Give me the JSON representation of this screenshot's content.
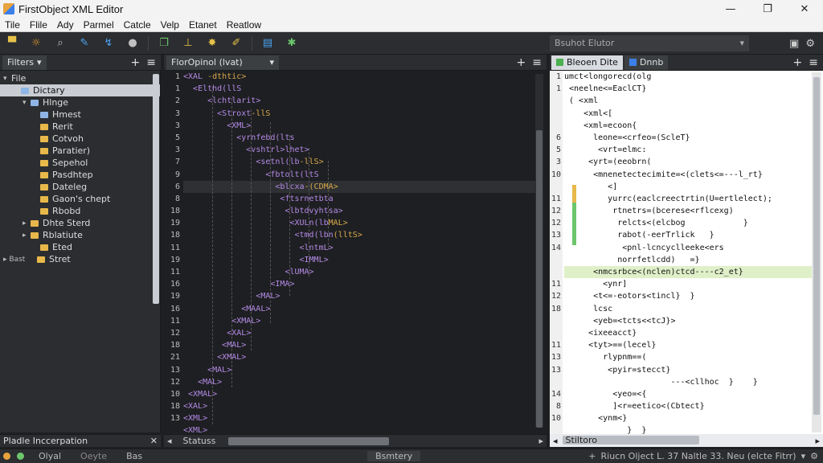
{
  "window": {
    "title": "FirstObject XML Editor",
    "controls": [
      "—",
      "❐",
      "✕"
    ]
  },
  "menu": [
    "Tile",
    "Flile",
    "Ady",
    "Parmel",
    "Catcle",
    "Velp",
    "Etanet",
    "Reatlow"
  ],
  "toolbar": {
    "icons": [
      {
        "name": "save-icon",
        "glyph": "▀",
        "color": "c1"
      },
      {
        "name": "sun-icon",
        "glyph": "☼",
        "color": "c2"
      },
      {
        "name": "search-icon",
        "glyph": "⌕",
        "color": "c3"
      },
      {
        "name": "pencil-icon",
        "glyph": "✎",
        "color": "c4"
      },
      {
        "name": "arrow-icon",
        "glyph": "↯",
        "color": "c4"
      },
      {
        "name": "magnifier-icon",
        "glyph": "●",
        "color": "c3"
      },
      {
        "name": "copy-icon",
        "glyph": "❐",
        "color": "c5"
      },
      {
        "name": "pin-icon",
        "glyph": "⊥",
        "color": "c1"
      },
      {
        "name": "star-icon",
        "glyph": "✸",
        "color": "c1"
      },
      {
        "name": "brush-icon",
        "glyph": "✐",
        "color": "c1"
      },
      {
        "name": "layers-icon",
        "glyph": "▤",
        "color": "c4"
      },
      {
        "name": "bug-icon",
        "glyph": "✱",
        "color": "c5"
      }
    ]
  },
  "left_panel": {
    "tab_label": "Filters",
    "tree": [
      {
        "label": "File",
        "arrow": "▾",
        "indent": 0,
        "folder": "",
        "sel": false
      },
      {
        "label": "Dictary",
        "arrow": "",
        "indent": 1,
        "folder": "blue",
        "sel": true
      },
      {
        "label": "Hlnge",
        "arrow": "▾",
        "indent": 2,
        "folder": "blue",
        "sel": false
      },
      {
        "label": "Hmest",
        "arrow": "",
        "indent": 3,
        "folder": "blue",
        "sel": false
      },
      {
        "label": "Rerit",
        "arrow": "",
        "indent": 3,
        "folder": "yellow",
        "sel": false
      },
      {
        "label": "Cotvoh",
        "arrow": "",
        "indent": 3,
        "folder": "yellow",
        "sel": false
      },
      {
        "label": "Paratier)",
        "arrow": "",
        "indent": 3,
        "folder": "yellow",
        "sel": false
      },
      {
        "label": "Sepehol",
        "arrow": "",
        "indent": 3,
        "folder": "yellow",
        "sel": false
      },
      {
        "label": "Pasdhtep",
        "arrow": "",
        "indent": 3,
        "folder": "yellow",
        "sel": false
      },
      {
        "label": "Dateleg",
        "arrow": "",
        "indent": 3,
        "folder": "yellow",
        "sel": false
      },
      {
        "label": "Gaon's chept",
        "arrow": "",
        "indent": 3,
        "folder": "yellow",
        "sel": false
      },
      {
        "label": "Rbobd",
        "arrow": "",
        "indent": 3,
        "folder": "yellow",
        "sel": false
      },
      {
        "label": "Dhte Sterd",
        "arrow": "▸",
        "indent": 2,
        "folder": "yellow",
        "sel": false
      },
      {
        "label": "Rblatiute",
        "arrow": "▸",
        "indent": 2,
        "folder": "yellow",
        "sel": false
      },
      {
        "label": "Eted",
        "arrow": "",
        "indent": 3,
        "folder": "yellow",
        "sel": false
      },
      {
        "label": "Stret",
        "arrow": "▸ Bast",
        "indent": 0,
        "folder": "yellow",
        "sel": false
      }
    ],
    "bottom_label": "Pladle Inccerpation"
  },
  "editor": {
    "tab_label": "FlorOpinol (lvat)",
    "gutter": [
      "1",
      "1",
      "2",
      "3",
      "3",
      "5",
      "3",
      "7",
      "9",
      "6",
      "8",
      "18",
      "19",
      "18",
      "11",
      "19",
      "11",
      "16",
      "19",
      "16",
      "11",
      "12",
      "18",
      "21",
      "13",
      "12",
      "10",
      "18",
      "13",
      "",
      ""
    ],
    "lines": [
      {
        "pre": "",
        "tag": "<XAL",
        "attr": " -dthtic>"
      },
      {
        "pre": "  ",
        "tag": "<Elthd(llS",
        "attr": ""
      },
      {
        "pre": "     ",
        "tag": "<lchtlarit>",
        "attr": ""
      },
      {
        "pre": "       ",
        "tag": "<Stroxt",
        "attr": "-llS"
      },
      {
        "pre": "         ",
        "tag": "<XML>",
        "attr": ""
      },
      {
        "pre": "           ",
        "tag": "<yrnfebd(lts",
        "attr": ""
      },
      {
        "pre": "             ",
        "tag": "<vshtrl>lhet>",
        "attr": ""
      },
      {
        "pre": "               ",
        "tag": "<setnl(lb",
        "attr": "-llS>"
      },
      {
        "pre": "                 ",
        "tag": "<fbtolt(ltS",
        "attr": ""
      },
      {
        "pre": "                   ",
        "tag": "<blcxa",
        "attr": "-(CDMA>"
      },
      {
        "pre": "                    ",
        "tag": "<ftsrnetbta",
        "attr": ""
      },
      {
        "pre": "                     ",
        "tag": "<lbtdvyhtsa>",
        "attr": ""
      },
      {
        "pre": "                      ",
        "tag": "<XULn(lb",
        "attr": "MAL>"
      },
      {
        "pre": "                       ",
        "tag": "<tmd(lbn",
        "attr": "(lltS>"
      },
      {
        "pre": "                        ",
        "tag": "<lntmL>",
        "attr": ""
      },
      {
        "pre": "                        ",
        "tag": "<IMML>",
        "attr": ""
      },
      {
        "pre": "                     ",
        "tag": "<lUMA>",
        "attr": ""
      },
      {
        "pre": "                  ",
        "tag": "<IMA>",
        "attr": ""
      },
      {
        "pre": "               ",
        "tag": "<MAL>",
        "attr": ""
      },
      {
        "pre": "            ",
        "tag": "<MAAL>",
        "attr": ""
      },
      {
        "pre": "          ",
        "tag": "<XMAL>",
        "attr": ""
      },
      {
        "pre": "         ",
        "tag": "<XAL>",
        "attr": ""
      },
      {
        "pre": "        ",
        "tag": "<MAL>",
        "attr": ""
      },
      {
        "pre": "       ",
        "tag": "<XMAL>",
        "attr": ""
      },
      {
        "pre": "     ",
        "tag": "<MAL>",
        "attr": ""
      },
      {
        "pre": "   ",
        "tag": "<MAL>",
        "attr": ""
      },
      {
        "pre": " ",
        "tag": "<XMAL>",
        "attr": ""
      },
      {
        "pre": "",
        "tag": "<XAL>",
        "attr": ""
      },
      {
        "pre": "",
        "tag": "<XML>",
        "attr": ""
      },
      {
        "pre": "",
        "tag": "<XML>",
        "attr": ""
      },
      {
        "pre": "",
        "tag": "<ML>",
        "attr": ""
      }
    ],
    "bottom_label": "Statuss"
  },
  "right_pane": {
    "top_tab_label": "Bsuhot Elutor",
    "tabs": [
      {
        "label": "Bleoen Dite",
        "active": true
      },
      {
        "label": "Dnnb",
        "active": false
      }
    ],
    "gutter": [
      "1",
      "1",
      "",
      "",
      "",
      "6",
      "5",
      "3",
      "10",
      "",
      "11",
      "12",
      "12",
      "13",
      "14",
      "",
      "",
      "11",
      "12",
      "18",
      "",
      "",
      "11",
      "13",
      "13",
      "",
      "14",
      "8",
      "10"
    ],
    "lines": [
      "umct<longorecd(olg",
      " <neelne<=EaclCT}",
      " ( <xml",
      "    <xml<[",
      "    <xml=ecoon{",
      "      leone=<crfeo=(ScleT}",
      "       <vrt=elmc:",
      "     <yrt=(eeobrn(",
      "      <mnenetectecimite=<(clets<=---l_rt}",
      "         <]",
      "         yurrc(eaclcreectrtin(U=ertlelect);",
      "          rtnetrs=(bcerese<rflcexg)",
      "           relcts<(elcbog            }",
      "           rabot(-eerTrlick   }",
      "            <pnl-lcncyclleeke<ers",
      "           norrfetlcdd)   =}",
      "      <nmcsrbce<(nclen)ctcd----c2_et}",
      "        <ynr]",
      "      <t<=-eotors<tincl}  }",
      "      lcsc",
      "      <yeb=<tcts<<tcJ}>",
      "     <ixeeacct}",
      "     <tyt>==(lecel}",
      "        rlypnm==(",
      "         <pyir=stecct}",
      "                      ---<cllhoc  }    }",
      "          <yeo=<{",
      "          ]<r=eetico<(Cbtect}",
      "       <ynm<}",
      "             }  }",
      "    }   <yiet<{"
    ],
    "hl_line": 16,
    "bottom_label": "Stiltoro"
  },
  "status": {
    "left": [
      "Olyal",
      "Oeyte",
      "Bas"
    ],
    "center": "Bsmtery",
    "right": "Riucn Olject L. 37 Naltle 33. Neu (elcte Fitrr)"
  }
}
